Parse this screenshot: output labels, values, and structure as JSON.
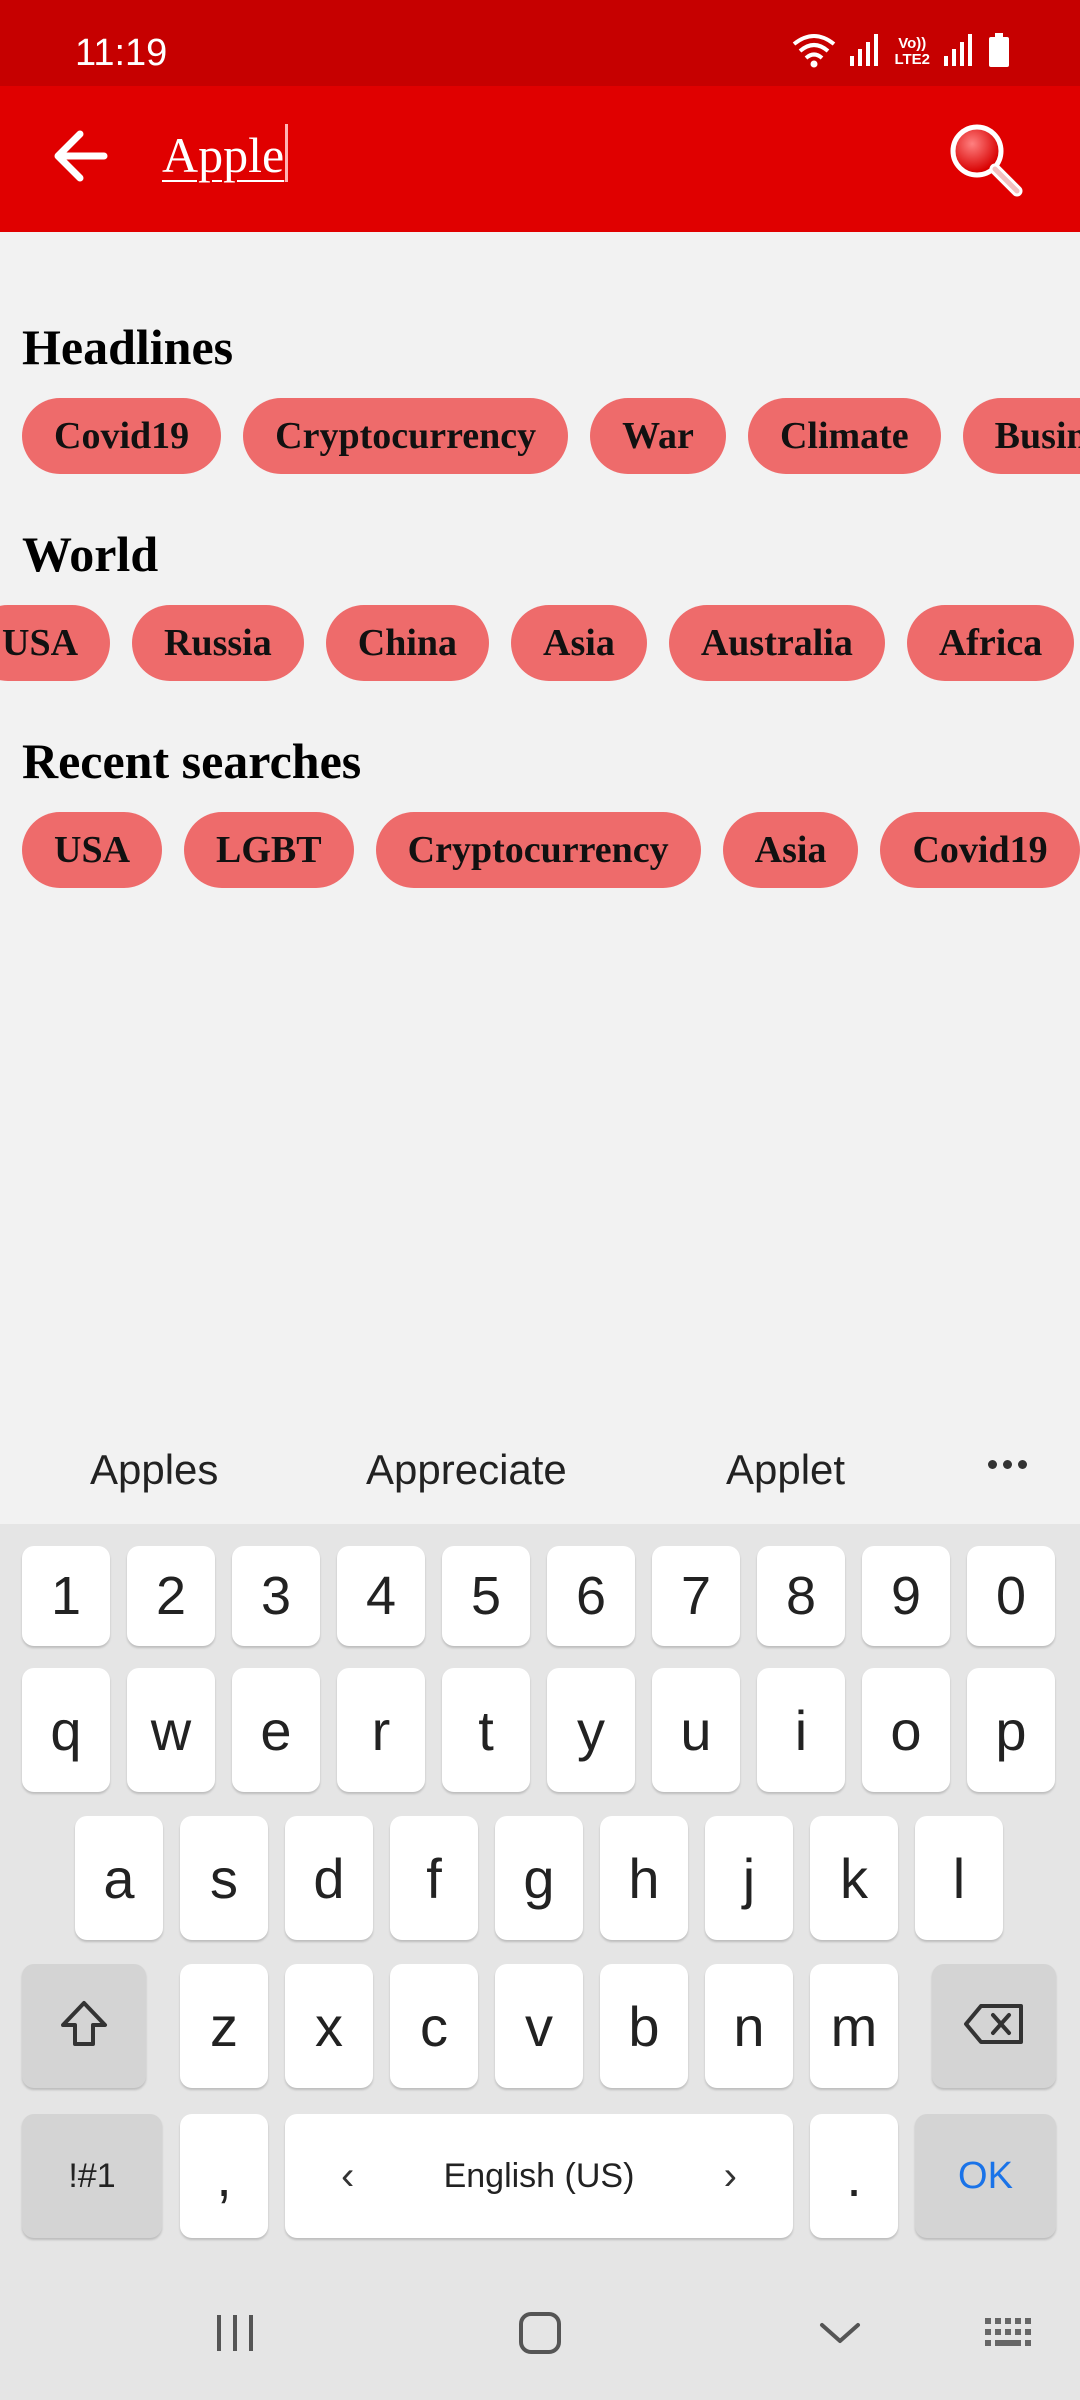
{
  "status_bar": {
    "time": "11:19",
    "volte_line1": "Vo))",
    "volte_line2": "LTE2"
  },
  "search": {
    "query": "Apple"
  },
  "sections": [
    {
      "title": "Headlines",
      "chips": [
        "Covid19",
        "Cryptocurrency",
        "War",
        "Climate",
        "Business"
      ]
    },
    {
      "title": "World",
      "chips": [
        "USA",
        "Russia",
        "China",
        "Asia",
        "Australia",
        "Africa"
      ]
    },
    {
      "title": "Recent searches",
      "chips": [
        "USA",
        "LGBT",
        "Cryptocurrency",
        "Asia",
        "Covid19"
      ]
    }
  ],
  "suggestions": [
    "Apples",
    "Appreciate",
    "Applet"
  ],
  "keyboard": {
    "number_row": [
      "1",
      "2",
      "3",
      "4",
      "5",
      "6",
      "7",
      "8",
      "9",
      "0"
    ],
    "row1": [
      "q",
      "w",
      "e",
      "r",
      "t",
      "y",
      "u",
      "i",
      "o",
      "p"
    ],
    "row2": [
      "a",
      "s",
      "d",
      "f",
      "g",
      "h",
      "j",
      "k",
      "l"
    ],
    "row3": [
      "z",
      "x",
      "c",
      "v",
      "b",
      "n",
      "m"
    ],
    "symbols_label": "!#1",
    "comma_label": ",",
    "space_label": "English (US)",
    "period_label": ".",
    "ok_label": "OK"
  },
  "colors": {
    "status_bar": "#c60000",
    "app_bar": "#e00000",
    "chip": "#ee6b6b",
    "ok_text": "#1a73e8"
  },
  "icons": [
    "wifi-icon",
    "signal-icon",
    "battery-icon",
    "back-arrow-icon",
    "search-icon",
    "shift-icon",
    "backspace-icon",
    "recents-icon",
    "home-icon",
    "hide-keyboard-icon",
    "keyboard-icon"
  ]
}
